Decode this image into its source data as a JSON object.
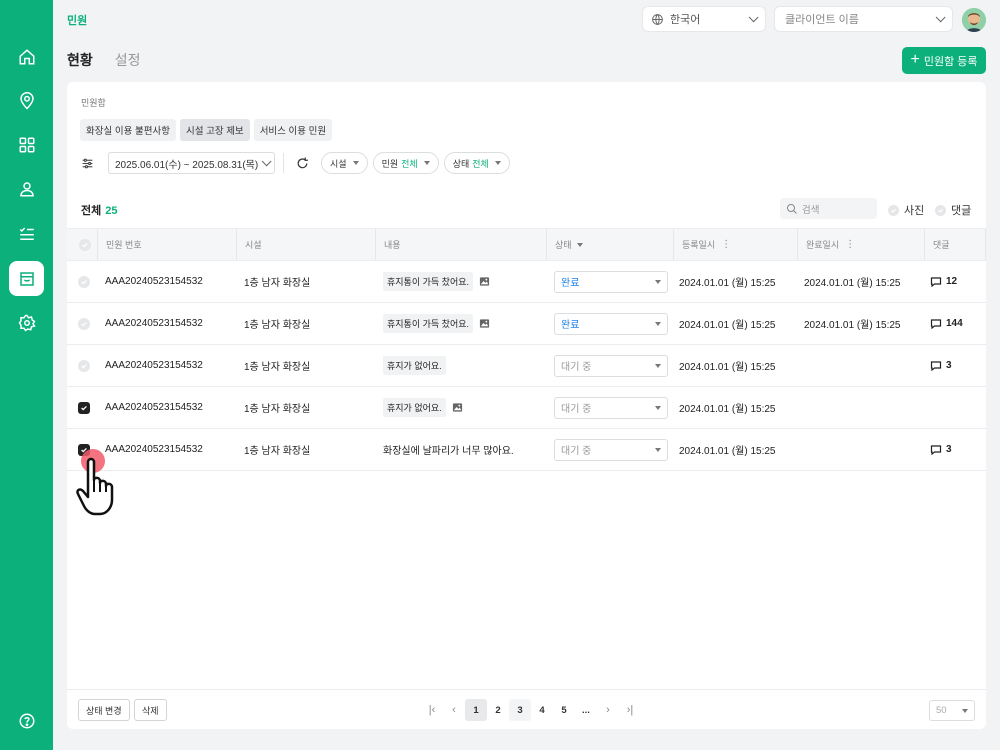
{
  "header": {
    "breadcrumb": "민원",
    "language": "한국어",
    "client_placeholder": "클라이언트 이름"
  },
  "tabs": [
    {
      "label": "현황",
      "active": true
    },
    {
      "label": "설정",
      "active": false
    }
  ],
  "add_button": "민원함 등록",
  "box_label": "민원함",
  "categories": [
    {
      "label": "화장실 이용 불편사항",
      "active": false
    },
    {
      "label": "시설 고장 제보",
      "active": true
    },
    {
      "label": "서비스 이용 민원",
      "active": false
    }
  ],
  "filters": {
    "date_range": "2025.06.01(수) ~ 2025.08.31(목)",
    "facility": "시설",
    "complaint_label": "민원",
    "complaint_value": "전체",
    "status_label": "상태",
    "status_value": "전체"
  },
  "summary": {
    "total_label": "전체",
    "total_count": "25"
  },
  "search_placeholder": "검색",
  "toggles": {
    "photo": "사진",
    "comments": "댓글"
  },
  "columns": [
    "민원 번호",
    "시설",
    "내용",
    "상태",
    "등록일시",
    "완료일시",
    "댓글"
  ],
  "rows": [
    {
      "checked": false,
      "id": "AAA20240523154532",
      "facility": "1층 남자 화장실",
      "content": "휴지통이 가득 찼어요.",
      "content_tag": true,
      "has_image": true,
      "status": "완료",
      "registered": "2024.01.01 (월) 15:25",
      "completed": "2024.01.01 (월) 15:25",
      "comments": "12"
    },
    {
      "checked": false,
      "id": "AAA20240523154532",
      "facility": "1층 남자 화장실",
      "content": "휴지통이 가득 찼어요.",
      "content_tag": true,
      "has_image": true,
      "status": "완료",
      "registered": "2024.01.01 (월) 15:25",
      "completed": "2024.01.01 (월) 15:25",
      "comments": "144"
    },
    {
      "checked": false,
      "id": "AAA20240523154532",
      "facility": "1층 남자 화장실",
      "content": "휴지가 없어요.",
      "content_tag": true,
      "has_image": false,
      "status": "대기 중",
      "registered": "2024.01.01 (월) 15:25",
      "completed": "",
      "comments": "3"
    },
    {
      "checked": true,
      "id": "AAA20240523154532",
      "facility": "1층 남자 화장실",
      "content": "휴지가 없어요.",
      "content_tag": true,
      "has_image": true,
      "status": "대기 중",
      "registered": "2024.01.01 (월) 15:25",
      "completed": "",
      "comments": ""
    },
    {
      "checked": true,
      "id": "AAA20240523154532",
      "facility": "1층 남자 화장실",
      "content": "화장실에 날파리가 너무 많아요.",
      "content_tag": false,
      "has_image": false,
      "status": "대기 중",
      "registered": "2024.01.01 (월) 15:25",
      "completed": "",
      "comments": "3"
    }
  ],
  "footer": {
    "change_status": "상태 변경",
    "delete": "삭제",
    "pages": [
      "1",
      "2",
      "3",
      "4",
      "5",
      "..."
    ],
    "current_page": "1",
    "per_page": "50"
  },
  "colors": {
    "brand": "#0bb07b",
    "done_status": "#1e7fe8"
  },
  "icons": [
    "home-icon",
    "location-pin-icon",
    "grid-icon",
    "user-icon",
    "checklist-icon",
    "inbox-icon",
    "settings-icon",
    "help-icon",
    "globe-icon",
    "search-icon",
    "refresh-icon",
    "sliders-icon",
    "comment-icon",
    "image-icon",
    "hand-cursor-icon"
  ]
}
